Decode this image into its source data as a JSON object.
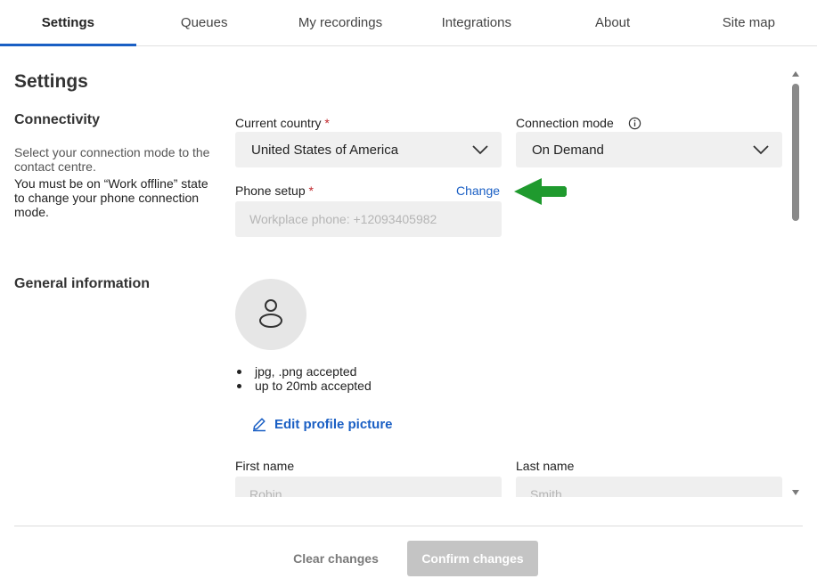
{
  "tabs": [
    {
      "label": "Settings",
      "active": true
    },
    {
      "label": "Queues"
    },
    {
      "label": "My recordings"
    },
    {
      "label": "Integrations"
    },
    {
      "label": "About"
    },
    {
      "label": "Site map"
    }
  ],
  "page": {
    "title": "Settings"
  },
  "connectivity": {
    "title": "Connectivity",
    "description": "Select your connection mode to the contact centre.",
    "note": "You must be on “Work offline” state to change your phone connection mode.",
    "country_label": "Current country",
    "country_value": "United States of America",
    "mode_label": "Connection mode",
    "mode_value": "On Demand",
    "phone_label": "Phone setup",
    "phone_placeholder": "Workplace phone: +12093405982",
    "change_link": "Change",
    "required_mark": "*"
  },
  "general": {
    "title": "General information",
    "bullets": [
      "jpg, .png accepted",
      "up to 20mb accepted"
    ],
    "edit_picture": "Edit profile picture",
    "first_name_label": "First name",
    "first_name_value": "Robin",
    "last_name_label": "Last name",
    "last_name_value": "Smith"
  },
  "footer": {
    "clear_label": "Clear changes",
    "confirm_label": "Confirm changes"
  },
  "icons": {
    "info": "info-icon",
    "chevron": "chevron-down-icon",
    "avatar": "user-icon",
    "edit": "pencil-icon",
    "arrow": "arrow-left-icon"
  },
  "colors": {
    "accent": "#1a5fc4",
    "required": "#c0282d",
    "annotation_arrow": "#1f9a2e",
    "disabled_button": "#c4c4c4"
  }
}
